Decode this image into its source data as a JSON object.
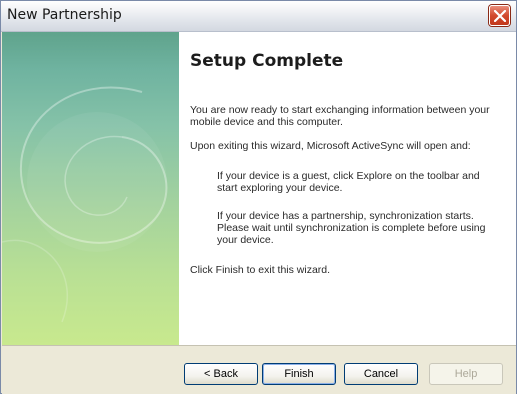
{
  "window": {
    "title": "New Partnership"
  },
  "content": {
    "heading": "Setup Complete",
    "para1": "You are now ready to start exchanging information between your mobile device and this computer.",
    "para2": "Upon exiting this wizard, Microsoft ActiveSync will open and:",
    "bullet1": "If your device is a guest, click Explore on the toolbar and start exploring your device.",
    "bullet2": "If your device has a partnership, synchronization starts. Please wait until synchronization is complete before using your device.",
    "para3": "Click Finish to exit this wizard."
  },
  "buttons": {
    "back": "< Back",
    "finish": "Finish",
    "cancel": "Cancel",
    "help": "Help"
  },
  "colors": {
    "panel_green": "#8fcaa2",
    "close_red": "#d24a2e"
  }
}
